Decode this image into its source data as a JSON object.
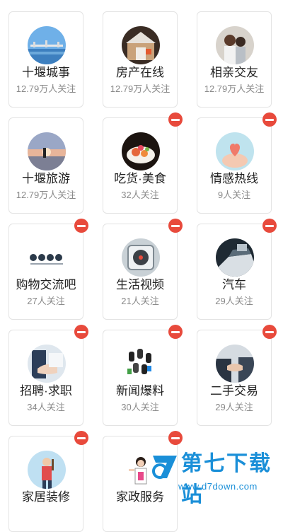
{
  "cards": [
    {
      "name": "十堰城事",
      "followers": "12.79万人关注",
      "removable": false,
      "icon": "bridge-photo-icon"
    },
    {
      "name": "房产在线",
      "followers": "12.79万人关注",
      "removable": false,
      "icon": "house-model-photo-icon"
    },
    {
      "name": "相亲交友",
      "followers": "12.79万人关注",
      "removable": false,
      "icon": "couple-photo-icon"
    },
    {
      "name": "十堰旅游",
      "followers": "12.79万人关注",
      "removable": false,
      "icon": "beach-runner-photo-icon"
    },
    {
      "name": "吃货·美食",
      "followers": "32人关注",
      "removable": true,
      "icon": "food-photo-icon"
    },
    {
      "name": "情感热线",
      "followers": "9人关注",
      "removable": true,
      "icon": "heart-hands-photo-icon"
    },
    {
      "name": "购物交流吧",
      "followers": "27人关注",
      "removable": true,
      "icon": "shopping-logo-icon"
    },
    {
      "name": "生活视频",
      "followers": "21人关注",
      "removable": true,
      "icon": "video-disc-icon"
    },
    {
      "name": "汽车",
      "followers": "29人关注",
      "removable": true,
      "icon": "car-photo-icon"
    },
    {
      "name": "招聘·求职",
      "followers": "34人关注",
      "removable": true,
      "icon": "handshake-photo-icon"
    },
    {
      "name": "新闻爆料",
      "followers": "30人关注",
      "removable": true,
      "icon": "microphones-photo-icon"
    },
    {
      "name": "二手交易",
      "followers": "29人关注",
      "removable": true,
      "icon": "business-handshake-photo-icon"
    },
    {
      "name": "家居装修",
      "followers": "",
      "removable": true,
      "icon": "painter-photo-icon"
    },
    {
      "name": "家政服务",
      "followers": "",
      "removable": true,
      "icon": "housekeeper-photo-icon"
    }
  ],
  "watermark": {
    "title": "第七下载站",
    "url": "www.d7down.com"
  },
  "colors": {
    "remove_badge": "#e84a3c",
    "card_border": "#e3e3e3",
    "name_text": "#222222",
    "followers_text": "#8a8a8a",
    "watermark": "#1a8fd8"
  }
}
